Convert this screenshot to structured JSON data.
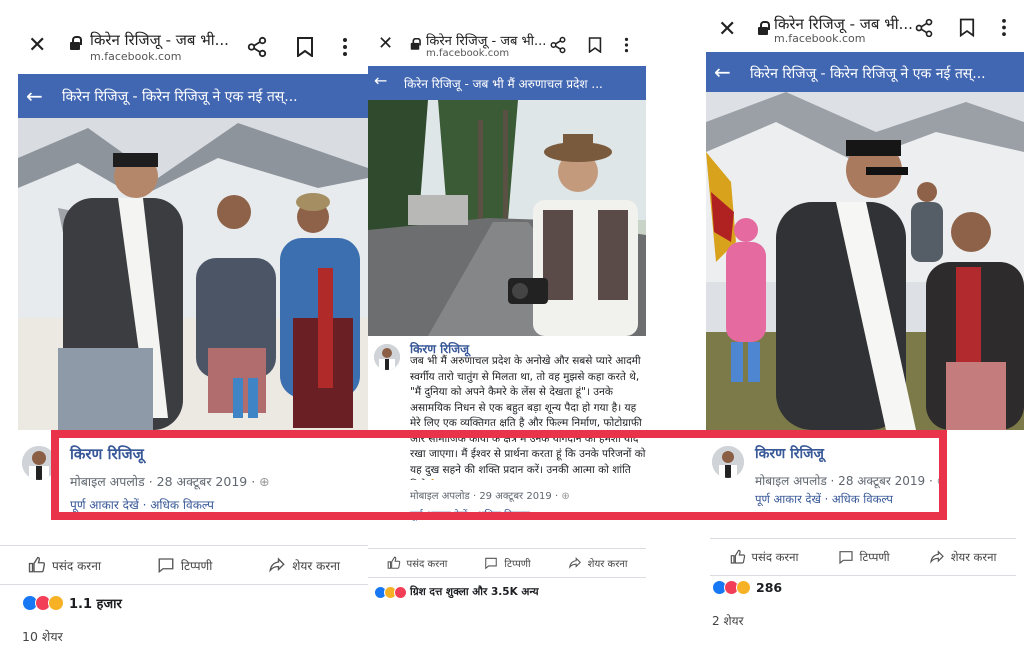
{
  "left": {
    "chrome": {
      "title": "किरेन रिजिजू - जब भी...",
      "url": "m.facebook.com"
    },
    "bar_title": "किरेन रिजिजू - किरेन रिजिजू ने एक नई तस्...",
    "author": "किरण रिजिजू",
    "meta": "मोबाइल अपलोड · 28 अक्टूबर 2019 · ",
    "links": "पूर्ण आकार देखें · अधिक विकल्प",
    "actions": {
      "like": "पसंद करना",
      "comment": "टिप्पणी",
      "share": "शेयर करना"
    },
    "reactions_count": "1.1 हजार",
    "shares": "10 शेयर"
  },
  "middle": {
    "chrome": {
      "title": "किरेन रिजिजू - जब भी...",
      "url": "m.facebook.com"
    },
    "bar_title": "किरेन रिजिजू - जब भी मैं अरुणाचल प्रदेश ...",
    "author": "किरण रिजिजू",
    "caption": "जब भी मैं अरुणाचल प्रदेश के अनोखे और सबसे प्यारे आदमी स्वर्गीय तारो चातुंग से मिलता था, तो वह मुझसे कहा करते थे, \"मैं दुनिया को अपने कैमरे के लेंस से देखता हूं\"। उनके असामयिक निधन से एक बहुत बड़ा शून्य पैदा हो गया है। यह मेरे लिए एक व्यक्तिगत क्षति है और फिल्म निर्माण, फोटोग्राफी और सामाजिक कार्यों के क्षेत्र में उनके योगदान को हमेशा याद रखा जाएगा। मैं ईश्वर से प्रार्थना करता हूं कि उनके परिजनों को यह दुख सहने की शक्ति प्रदान करें। उनकी आत्मा को शांति मिले🙏",
    "meta": "मोबाइल अपलोड · 29 अक्टूबर 2019 · ",
    "links": "पूर्ण आकार देखें · अधिक विकल्प",
    "actions": {
      "like": "पसंद करना",
      "comment": "टिप्पणी",
      "share": "शेयर करना"
    },
    "reactions_count": "ग्रिश दत्त शुक्ला और 3.5K अन्य"
  },
  "right": {
    "chrome": {
      "title": "किरेन रिजिजू - जब भी...",
      "url": "m.facebook.com"
    },
    "bar_title": "किरेन रिजिजू - किरेन रिजिजू ने एक नई तस्...",
    "author": "किरण रिजिजू",
    "meta": "मोबाइल अपलोड · 28 अक्टूबर 2019 · ",
    "links": "पूर्ण आकार देखें · अधिक विकल्प",
    "actions": {
      "like": "पसंद करना",
      "comment": "टिप्पणी",
      "share": "शेयर करना"
    },
    "reactions_count": "286",
    "shares": "2 शेयर"
  },
  "colors": {
    "facebook_blue": "#4267b2",
    "highlight_red": "#e8334a",
    "link_blue": "#385898"
  },
  "icons": [
    "close-icon",
    "lock-icon",
    "share-icon",
    "bookmark-icon",
    "more-icon",
    "back-arrow-icon",
    "like-icon",
    "comment-icon",
    "share-arrow-icon",
    "globe-icon"
  ]
}
